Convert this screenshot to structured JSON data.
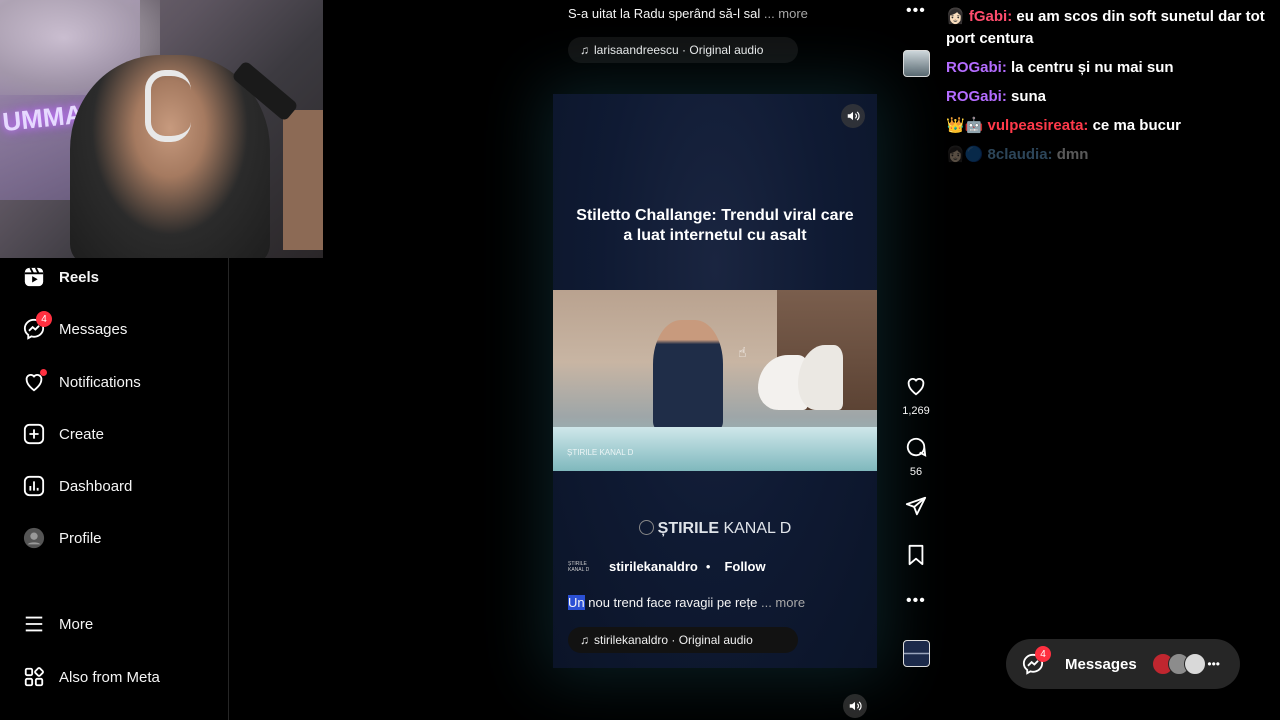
{
  "nav": {
    "items": [
      {
        "label": "Reels",
        "icon": "reels-icon",
        "active": true
      },
      {
        "label": "Messages",
        "icon": "messenger-icon",
        "badge": "4"
      },
      {
        "label": "Notifications",
        "icon": "heart-icon",
        "dot": true
      },
      {
        "label": "Create",
        "icon": "plus-square-icon"
      },
      {
        "label": "Dashboard",
        "icon": "chart-icon"
      },
      {
        "label": "Profile",
        "icon": "profile-avatar"
      }
    ],
    "more": "More",
    "also_from_meta": "Also from Meta"
  },
  "webcam": {
    "neon_text": "UMMAN X KICK"
  },
  "prev_post": {
    "caption": "S-a uitat la Radu sperând să-l sal",
    "more": "... more",
    "audio": "larisaandreescu · Original audio"
  },
  "reel": {
    "headline": "Stiletto Challange: Trendul viral care a luat internetul cu asalt",
    "logo_bold": "ȘTIRILE",
    "logo_rest": "KANAL D",
    "scene_bug": "ȘTIRILE KANAL D",
    "account": "stirilekanaldro",
    "avatar_text": "ȘTIRILE KANAL D",
    "separator": "•",
    "follow": "Follow",
    "caption_highlight": "Un",
    "caption_rest": "nou trend face ravagii pe rețe",
    "more": "... more",
    "audio": "stirilekanaldro · Original audio",
    "likes": "1,269",
    "comments": "56"
  },
  "chat": [
    {
      "user": "fGabi:",
      "text": "eu am scos din soft sunetul dar tot port centura",
      "color": "#ff4d6d",
      "badges": "👩🏻"
    },
    {
      "user": "ROGabi:",
      "text": "la centru și nu mai sun",
      "color": "#b46cff"
    },
    {
      "user": "ROGabi:",
      "text": "suna",
      "color": "#b46cff"
    },
    {
      "user": "vulpeasireata:",
      "text": "ce ma bucur",
      "color": "#ff3a4a",
      "badges": "👑🤖"
    },
    {
      "user": "8claudia:",
      "text": "dmn",
      "color": "#7fc7ff",
      "badges": "👩🏻🔵",
      "faded": true
    }
  ],
  "messages_bar": {
    "label": "Messages",
    "badge": "4"
  },
  "colors": {
    "accent_red": "#ff3040",
    "highlight": "#2b50d4",
    "pill_bg": "#121212"
  }
}
